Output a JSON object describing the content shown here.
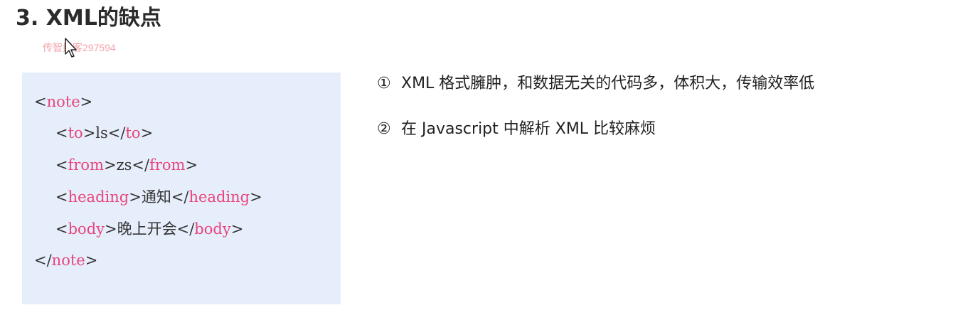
{
  "title": "3. XML的缺点",
  "watermark": "传智播客297594",
  "code": {
    "lines": [
      {
        "open": "<",
        "tag": "note",
        "close": ">"
      },
      {
        "open": "<",
        "tag": "to",
        "mid": ">ls</",
        "tag2": "to",
        "close": ">"
      },
      {
        "open": "<",
        "tag": "from",
        "mid": ">zs</",
        "tag2": "from",
        "close": ">"
      },
      {
        "open": "<",
        "tag": "heading",
        "mid": ">通知</",
        "tag2": "heading",
        "close": ">"
      },
      {
        "open": "<",
        "tag": "body",
        "mid": ">晚上开会</",
        "tag2": "body",
        "close": ">"
      },
      {
        "open": "</",
        "tag": "note",
        "close": ">"
      }
    ]
  },
  "points": [
    {
      "marker": "①",
      "text": "XML 格式臃肿，和数据无关的代码多，体积大，传输效率低"
    },
    {
      "marker": "②",
      "text": "在 Javascript 中解析 XML 比较麻烦"
    }
  ],
  "colors": {
    "tag": "#e8457a",
    "code_bg": "#e6eefb",
    "watermark": "#f4a3a8"
  }
}
